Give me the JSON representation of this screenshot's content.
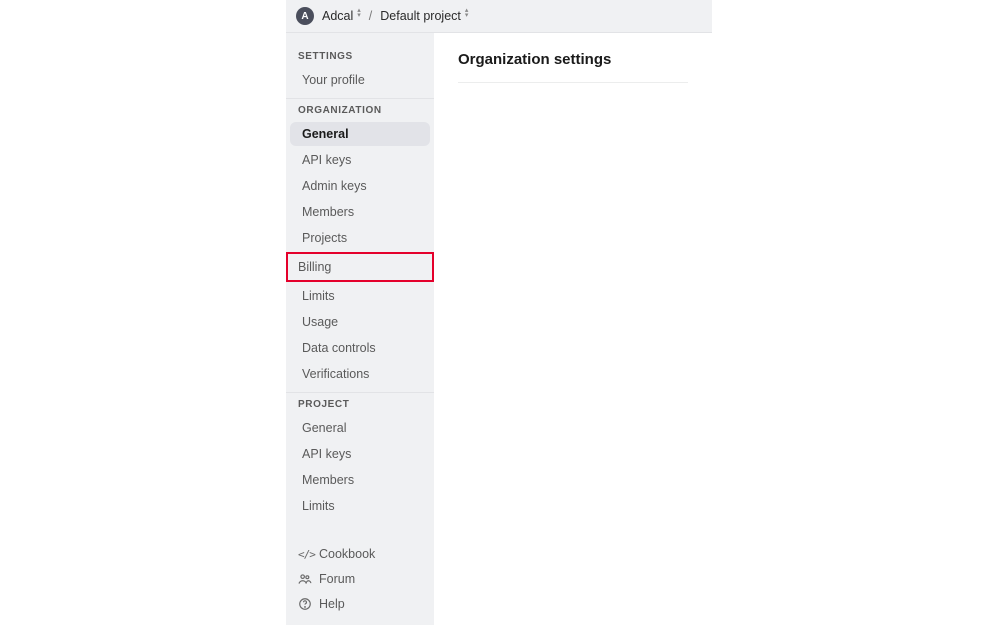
{
  "breadcrumb": {
    "avatar_letter": "A",
    "org": "Adcal",
    "project": "Default project"
  },
  "sidebar": {
    "sections": [
      {
        "header": "SETTINGS",
        "items": [
          "Your profile"
        ]
      },
      {
        "header": "ORGANIZATION",
        "items": [
          "General",
          "API keys",
          "Admin keys",
          "Members",
          "Projects",
          "Billing",
          "Limits",
          "Usage",
          "Data controls",
          "Verifications"
        ]
      },
      {
        "header": "PROJECT",
        "items": [
          "General",
          "API keys",
          "Members",
          "Limits"
        ]
      }
    ],
    "footer": [
      "Cookbook",
      "Forum",
      "Help"
    ]
  },
  "main": {
    "title": "Organization settings"
  },
  "active_item": "General",
  "highlighted_item": "Billing"
}
